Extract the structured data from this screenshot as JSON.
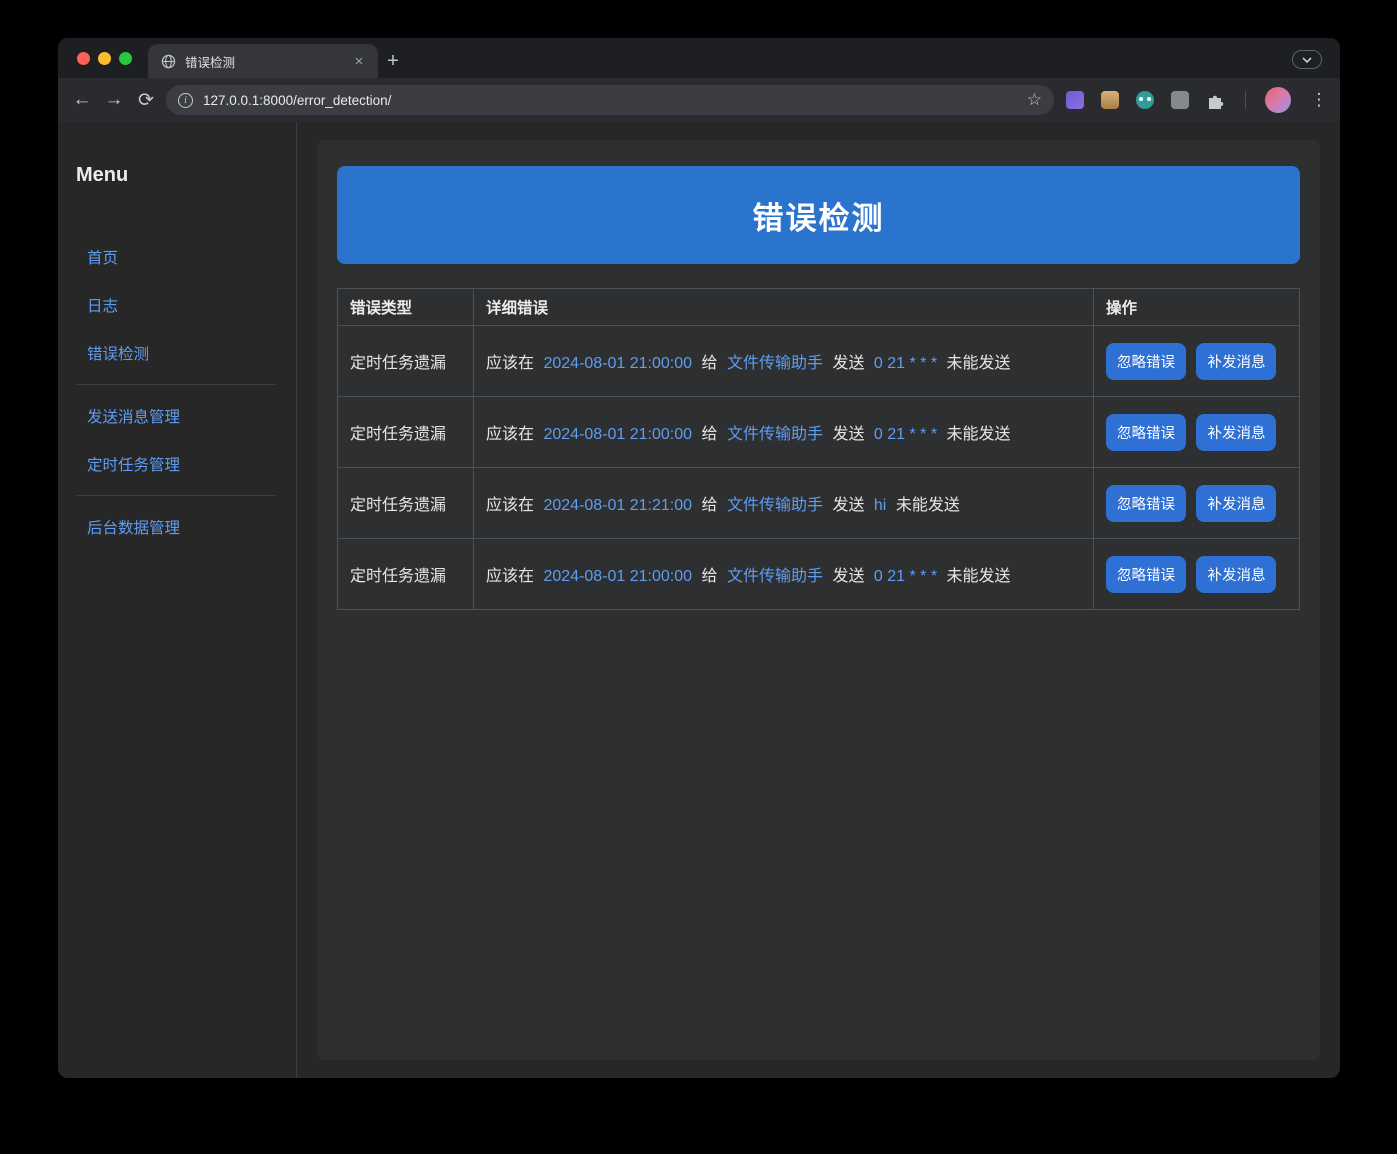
{
  "browser": {
    "tab_title": "错误检测",
    "url": "127.0.0.1:8000/error_detection/"
  },
  "colors": {
    "banner_blue": "#2b74cd",
    "button_blue": "#2e70d3",
    "link_blue": "#5f9df2"
  },
  "sidebar": {
    "title": "Menu",
    "items": [
      {
        "label": "首页"
      },
      {
        "label": "日志"
      },
      {
        "label": "错误检测"
      },
      {
        "label": "发送消息管理"
      },
      {
        "label": "定时任务管理"
      },
      {
        "label": "后台数据管理"
      }
    ]
  },
  "main": {
    "title": "错误检测",
    "table": {
      "headers": [
        "错误类型",
        "详细错误",
        "操作"
      ],
      "actions": {
        "ignore": "忽略错误",
        "resend": "补发消息"
      },
      "rows": [
        {
          "type": "定时任务遗漏",
          "detail": {
            "prefix": "应该在",
            "time": "2024-08-01 21:00:00",
            "mid1": "给",
            "contact": "文件传输助手",
            "mid2": "发送",
            "payload": "0 21 * * *",
            "suffix": "未能发送"
          }
        },
        {
          "type": "定时任务遗漏",
          "detail": {
            "prefix": "应该在",
            "time": "2024-08-01 21:00:00",
            "mid1": "给",
            "contact": "文件传输助手",
            "mid2": "发送",
            "payload": "0 21 * * *",
            "suffix": "未能发送"
          }
        },
        {
          "type": "定时任务遗漏",
          "detail": {
            "prefix": "应该在",
            "time": "2024-08-01 21:21:00",
            "mid1": "给",
            "contact": "文件传输助手",
            "mid2": "发送",
            "payload": "hi",
            "suffix": "未能发送"
          }
        },
        {
          "type": "定时任务遗漏",
          "detail": {
            "prefix": "应该在",
            "time": "2024-08-01 21:00:00",
            "mid1": "给",
            "contact": "文件传输助手",
            "mid2": "发送",
            "payload": "0 21 * * *",
            "suffix": "未能发送"
          }
        }
      ]
    }
  }
}
